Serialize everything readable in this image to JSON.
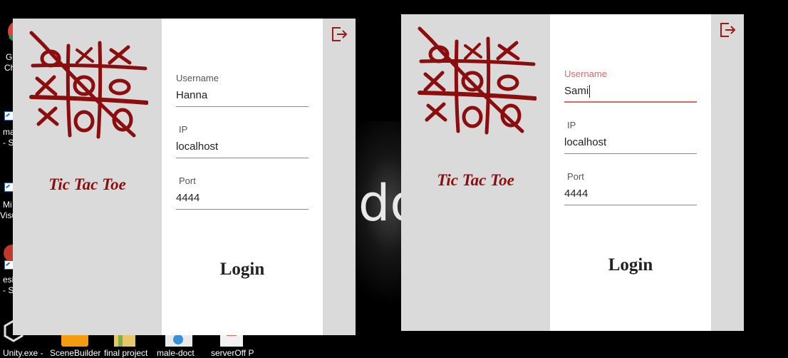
{
  "desktop": {
    "wallpaper_text": "do",
    "icons": [
      {
        "name": "chrome-shortcut",
        "lines": [
          "G",
          "Ch"
        ]
      },
      {
        "name": "mate-shortcut",
        "lines": [
          "mat",
          "- Sh"
        ]
      },
      {
        "name": "visual-studio-shortcut",
        "lines": [
          "Mi",
          "Visu"
        ]
      },
      {
        "name": "esip-shortcut",
        "lines": [
          "esip",
          "- Sh"
        ]
      }
    ],
    "taskbar_labels": [
      "Unity.exe -",
      "SceneBuilder",
      "final project",
      "male-doct",
      "serverOff P"
    ]
  },
  "windows": [
    {
      "title": "Tic Tac Toe",
      "username": {
        "label": "Username",
        "value": "Hanna"
      },
      "ip": {
        "label": "IP",
        "value": "localhost"
      },
      "port": {
        "label": "Port",
        "value": "4444"
      },
      "login_label": "Login"
    },
    {
      "title": "Tic Tac Toe",
      "username": {
        "label": "Username",
        "value": "Sami"
      },
      "ip": {
        "label": "IP",
        "value": "localhost"
      },
      "port": {
        "label": "Port",
        "value": "4444"
      },
      "login_label": "Login"
    }
  ],
  "colors": {
    "brand_red": "#8b0d0d",
    "focus_accent": "#e06666",
    "panel_gray": "#dadada"
  },
  "icons": {
    "logo": "tic-tac-toe-logo",
    "exit": "logout-icon"
  }
}
